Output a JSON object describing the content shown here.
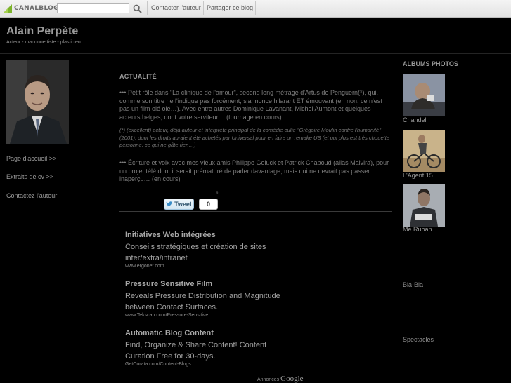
{
  "topbar": {
    "logo_text": "CANALBLOG",
    "search_placeholder": "",
    "links": [
      "Contacter l'auteur",
      "Partager ce blog"
    ]
  },
  "header": {
    "title": "Alain Perpète",
    "subtitle": "Acteur - marionnettiste - plasticien"
  },
  "sidebar": {
    "links": [
      "Page d'accueil >>",
      "Extraits de cv >>",
      "Contactez l'auteur"
    ]
  },
  "main": {
    "section_title": "ACTUALITÉ",
    "paragraphs": [
      "••• Petit rôle dans \"La clinique de l'amour\", second long métrage d'Artus de Penguern(*), qui, comme son titre ne l'indique pas forcément, s'annonce hilarant ET émouvant (eh non, ce n'est pas un film olé olé…). Avec entre autres Dominique Lavanant, Michel Aumont et quelques acteurs belges, dont votre serviteur… (tournage en cours)",
      "(*) (excellent) acteur, déjà auteur et interprète principal de la comédie culte \"Grégoire Moulin contre l'humanité\" (2001), dont les droits auraient été achetés par Universal pour en faire un remake US (et qui plus est très chouette personne, ce qui ne gâte rien…)",
      "••• Écriture et voix avec mes vieux amis Philippe Geluck et Patrick Chaboud (alias Malvira), pour un projet télé dont il serait prématuré de parler davantage, mais qui ne devrait pas passer inaperçu… (en cours)"
    ],
    "tweet_label": "Tweet",
    "tweet_count": "0",
    "hash": "#"
  },
  "ads": {
    "items": [
      {
        "title": "Initiatives Web intégrées",
        "desc": "Conseils stratégiques et création de sites inter/extra/intranet",
        "url": "www.ergonet.com"
      },
      {
        "title": "Pressure Sensitive Film",
        "desc": "Reveals Pressure Distribution and Magnitude between Contact Surfaces.",
        "url": "www.Tekscan.com/Pressure-Sensitive"
      },
      {
        "title": "Automatic Blog Content",
        "desc": "Find, Organize & Share Content! Content Curation Free for 30-days.",
        "url": "GetCurata.com/Content-Blogs"
      }
    ],
    "footer_label": "Annonces",
    "footer_brand": "Google"
  },
  "right_sidebar": {
    "albums_title": "ALBUMS PHOTOS",
    "albums": [
      {
        "label": "Chandel"
      },
      {
        "label": "L'Agent 15"
      },
      {
        "label": "Me Ruban"
      }
    ],
    "links": [
      "Bla-Bla",
      "Spectacles"
    ]
  },
  "colors": {
    "background": "#000000",
    "text": "#8a8a8a",
    "topbar": "#ececec"
  }
}
